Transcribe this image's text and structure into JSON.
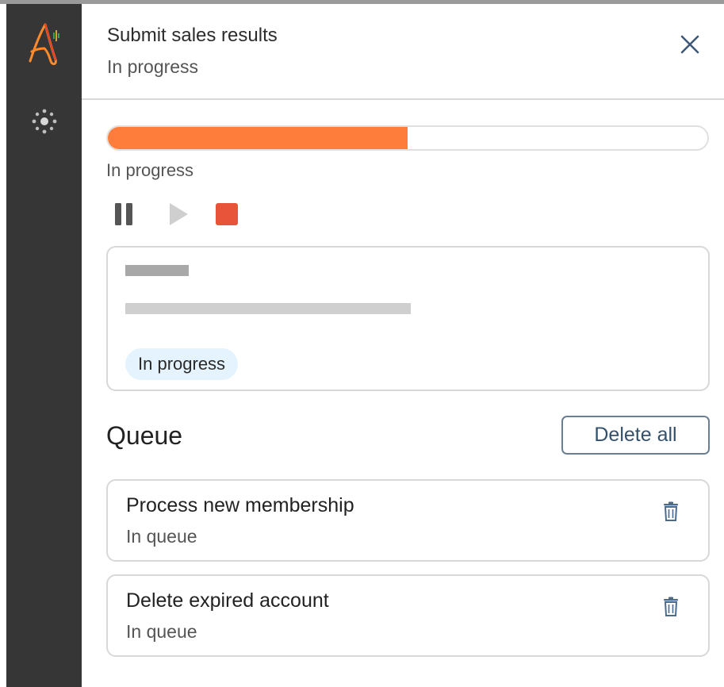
{
  "app": {
    "logo_icon": "app-logo-icon",
    "nav_icon": "hub-icon"
  },
  "header": {
    "title": "Submit sales results",
    "subtitle": "In progress",
    "close_icon": "close-icon"
  },
  "progress": {
    "percent": 50,
    "label": "In progress",
    "fill_color": "#ff7d3a"
  },
  "controls": {
    "pause_icon": "pause-icon",
    "play_icon": "play-icon",
    "stop_icon": "stop-icon",
    "stop_color": "#e8543a"
  },
  "task_card": {
    "status_chip": "In progress"
  },
  "queue": {
    "title": "Queue",
    "delete_all_label": "Delete all",
    "items": [
      {
        "name": "Process new membership",
        "status": "In queue",
        "icon": "trash-icon"
      },
      {
        "name": "Delete expired account",
        "status": "In queue",
        "icon": "trash-icon"
      }
    ]
  }
}
